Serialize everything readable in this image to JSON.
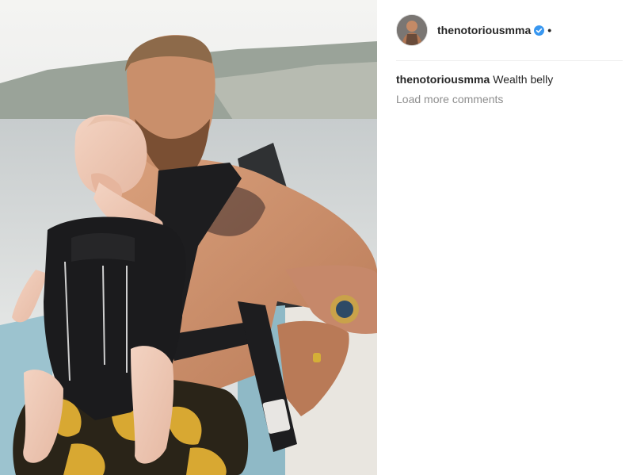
{
  "post": {
    "author": {
      "username": "thenotoriousmma",
      "verified": true,
      "separator": "•"
    },
    "caption": {
      "author": "thenotoriousmma",
      "text": "Wealth belly"
    },
    "load_more_label": "Load more comments",
    "icons": {
      "avatar": "profile-picture",
      "verified": "verified-badge-icon"
    },
    "colors": {
      "verified_blue": "#3897f0",
      "text_primary": "#262626",
      "text_secondary": "#8e8e8e",
      "divider": "#efefef"
    }
  }
}
